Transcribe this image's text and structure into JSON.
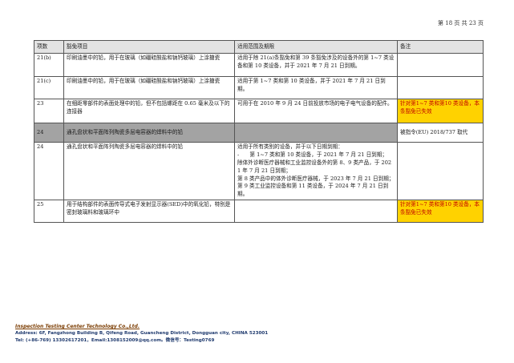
{
  "page_number": "第 18 页 共 23 页",
  "table": {
    "headers": [
      "项数",
      "豁免项目",
      "适用范围及期限",
      "备注"
    ],
    "rows": [
      {
        "no": "21(b)",
        "item": "印刷油墨中的铅，用于在玻璃（如硼硅酸盐和钠钙玻璃）上涂搪瓷",
        "scope": "适用于除 21(a)条豁免和第 39 条豁免涉及的设备外的第 1~7 类设备和第 10 类设备，并于 2021 年 7 月 21 日到期。",
        "remark": ""
      },
      {
        "no": "21(c)",
        "item": "印刷油墨中的铅，用于在玻璃（如硼硅酸盐和钠钙玻璃）上涂搪瓷",
        "scope": "适用于第 1~7 类和第 10 类设备，并于 2021 年 7 月 21 日到期。",
        "remark": ""
      },
      {
        "no": "23",
        "item": "在细距零部件的表面处理中的铅，但不包括螺距在 0.65 毫米及以下的连接器",
        "scope": "可用于在 2010 年 9 月 24 日前投放市场的电子电气设备的配件。",
        "remark": "针对第1~7 类和第10 类设备，本条豁免已失效"
      },
      {
        "no": "24",
        "item": "通孔盘状和平面阵列陶瓷多层电容器的焊料中的铅",
        "scope": "",
        "remark": "被指令(EU) 2018/737 取代"
      },
      {
        "no": "24",
        "item": "通孔盘状和平面阵列陶瓷多层电容器的焊料中的铅",
        "scope_lines": [
          "适用于所有类别的设备，并于以下日期到期：",
          "-　　第 1~7 类和第 10 类设备，于 2021 年 7 月 21 日到期；",
          "除体外诊断医疗器械和工业监控设备外的第 8、9 类产品，于 2021 年 7 月 21 日到期；",
          "第 8 类产品中的体外诊断医疗器械，于 2023 年 7 月 21 日到期；",
          "第 9 类工业监控设备和第 11 类设备，于 2024 年 7 月 21 日到期。"
        ],
        "remark": ""
      },
      {
        "no": "25",
        "item": "用于结构部件的表面传导式电子发射显示器(SED)中的氧化铅，特别是密封玻璃料和玻璃环中",
        "scope": "",
        "remark": "针对第1~7 类和第10 类设备，本条豁免已失效"
      }
    ]
  },
  "footer": {
    "company": "Inspection Testing Center Technology Co.,Ltd.",
    "address": "Address: 6F, Fangzhong Building B, Qifeng Road, Guancheng District, Dongguan city, CHINA 523001",
    "contact": "Tel: (+86-769) 13302617201，Email:1308152009@qq.com。微信号：Testing0769"
  },
  "colors": {
    "highlight": "#ffd200",
    "highlight_text": "#c00000",
    "grey_row": "#a3a3a3",
    "header_bg": "#e3e3e3",
    "footer_text": "#1f3a6e",
    "company_text": "#7a3b00"
  }
}
